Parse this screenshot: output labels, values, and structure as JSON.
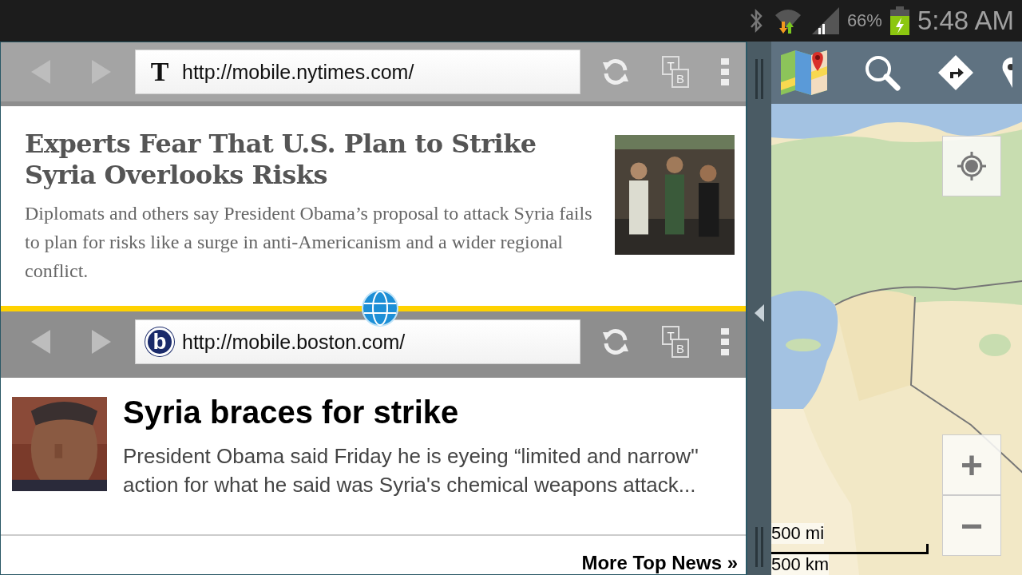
{
  "status_bar": {
    "battery": "66%",
    "time": "5:48 AM",
    "charging": true
  },
  "browser_windows": [
    {
      "url": "http://mobile.nytimes.com/",
      "favicon": "T",
      "kind": "serif",
      "reader_icon": [
        "T",
        "B"
      ],
      "headline": "Experts Fear That U.S. Plan to Strike Syria Overlooks Risks",
      "summary": "Diplomats and others say President Obama’s proposal to attack Syria fails to plan for risks like a surge in anti-Americanism and a wider regional conflict."
    },
    {
      "url": "http://mobile.boston.com/",
      "favicon": "b",
      "kind": "sans",
      "reader_icon": [
        "T",
        "B"
      ],
      "headline": "Syria braces for strike",
      "summary": "President Obama said Friday he is eyeing “limited and narrow'' action for what he said was Syria's chemical weapons attack...",
      "more_link": "More Top News »"
    }
  ],
  "map": {
    "zoom_in": "+",
    "zoom_out": "−",
    "scale": [
      "500 mi",
      "500 km"
    ]
  }
}
